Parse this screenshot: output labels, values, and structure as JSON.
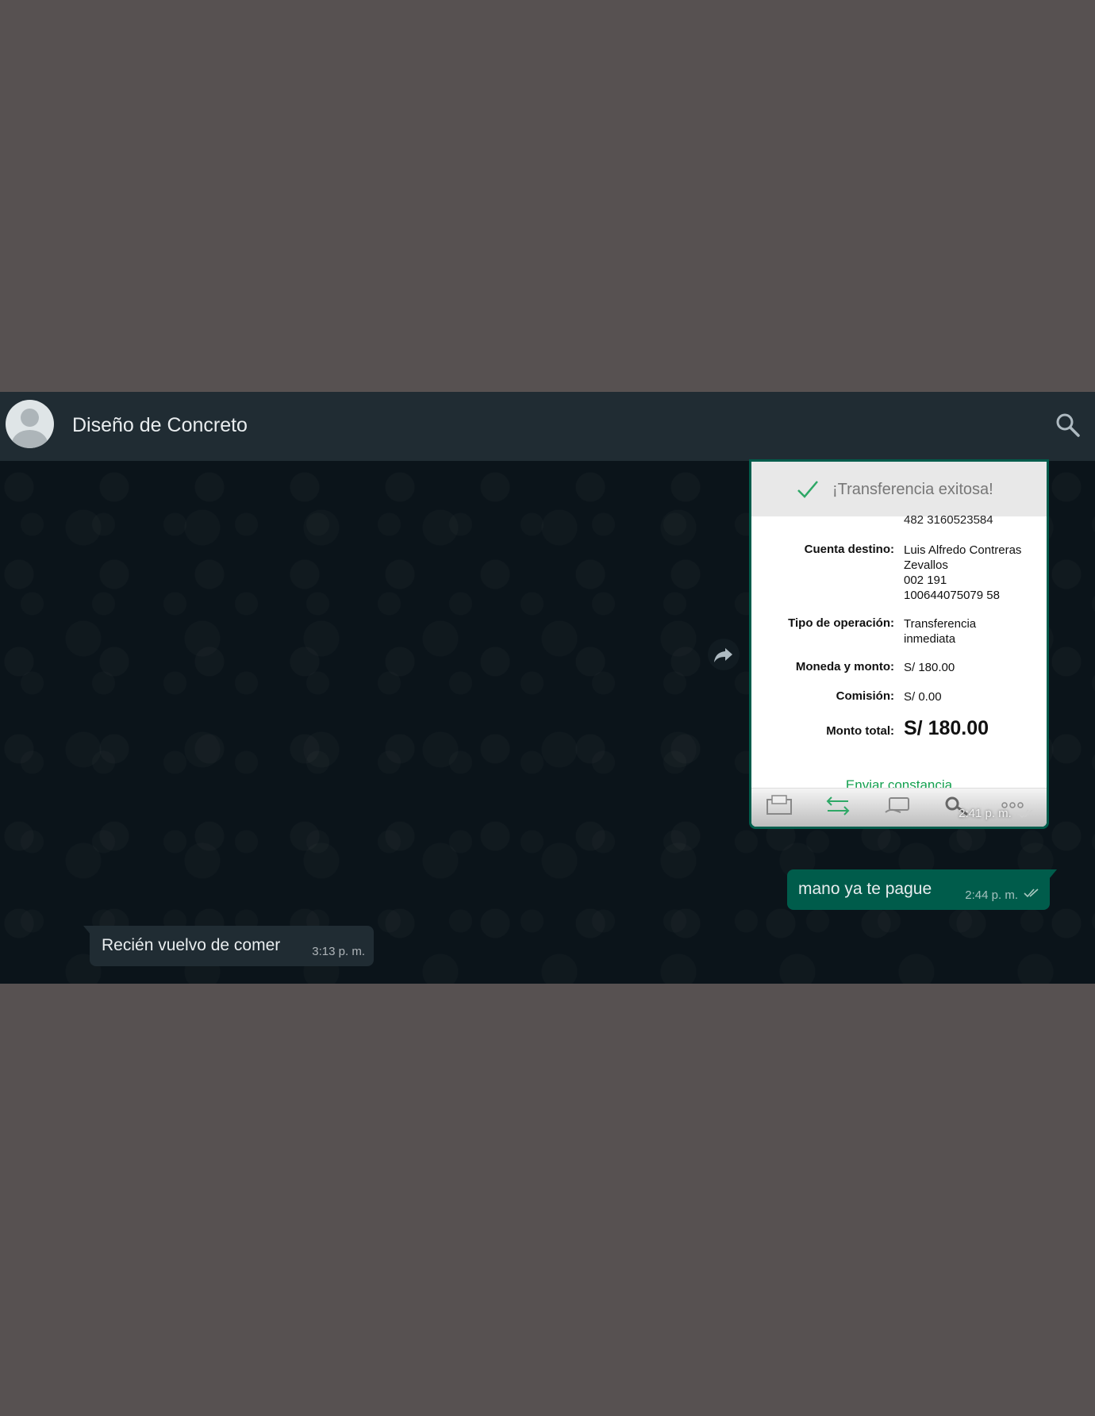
{
  "header": {
    "contact_name": "Diseño de Concreto",
    "avatar_icon": "default-avatar-icon",
    "search_icon": "search-icon"
  },
  "receipt": {
    "banner_text": "¡Transferencia exitosa!",
    "top_partial_number": "482 3160523584",
    "rows": [
      {
        "label": "Cuenta destino:",
        "lines": [
          "Luis Alfredo Contreras",
          "Zevallos",
          "002 191",
          "100644075079 58"
        ]
      },
      {
        "label": "Tipo de operación:",
        "lines": [
          "Transferencia",
          "inmediata"
        ]
      },
      {
        "label": "Moneda y monto:",
        "lines": [
          "S/ 180.00"
        ]
      },
      {
        "label": "Comisión:",
        "lines": [
          "S/ 0.00"
        ]
      }
    ],
    "total_label": "Monto total:",
    "total_value": "S/ 180.00",
    "send_link": "Enviar constancia",
    "time": "2:41 p. m."
  },
  "messages": {
    "outgoing": {
      "text": "mano ya te pague",
      "time": "2:44 p. m."
    },
    "incoming": {
      "text": "Recién vuelvo de comer",
      "time": "3:13 p. m."
    }
  },
  "colors": {
    "header_bg": "#202c33",
    "chat_bg": "#0b141a",
    "outgoing_bubble": "#005c4b",
    "incoming_bubble": "#202c33",
    "page_bg": "#575151",
    "receipt_accent": "#13a04f"
  }
}
